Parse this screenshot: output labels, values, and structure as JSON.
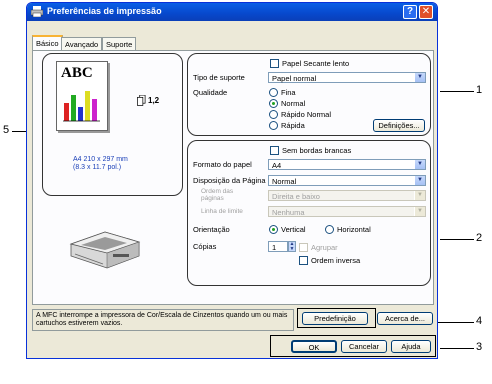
{
  "window": {
    "title": "Preferências de impressão",
    "help_label": "?",
    "close_label": "✕"
  },
  "tabs": [
    {
      "label": "Básico",
      "active": true
    },
    {
      "label": "Avançado",
      "active": false
    },
    {
      "label": "Suporte",
      "active": false
    }
  ],
  "preview": {
    "logo_text": "ABC",
    "page_size_text": "A4 210 x 297 mm",
    "page_size_inches": "(8.3 x 11.7 pol.)",
    "copies_indicator": "1,2"
  },
  "media": {
    "dry_paper_checkbox": {
      "label": "Papel Secante lento",
      "checked": false
    },
    "media_type_label": "Tipo de suporte",
    "media_type_value": "Papel normal",
    "quality_label": "Qualidade",
    "quality_options": [
      {
        "label": "Fina",
        "selected": false
      },
      {
        "label": "Normal",
        "selected": true
      },
      {
        "label": "Rápido Normal",
        "selected": false
      },
      {
        "label": "Rápida",
        "selected": false
      }
    ],
    "settings_button": "Definições..."
  },
  "layout": {
    "borderless_checkbox": {
      "label": "Sem bordas brancas",
      "checked": false
    },
    "paper_size_label": "Formato do papel",
    "paper_size_value": "A4",
    "page_layout_label": "Disposição da Página",
    "page_layout_value": "Normal",
    "page_order_label_1": "Ordem das",
    "page_order_label_2": "páginas",
    "page_order_value": "Direita e baixo",
    "border_line_label": "Linha de limite",
    "border_line_value": "Nenhuma",
    "orientation_label": "Orientação",
    "orientation_options": [
      {
        "label": "Vertical",
        "selected": true
      },
      {
        "label": "Horizontal",
        "selected": false
      }
    ],
    "copies_label": "Cópias",
    "copies_value": "1",
    "collate_label": "Agrupar",
    "reverse_order_label": "Ordem inversa"
  },
  "info_text": "A MFC interrompe a impressora de Cor/Escala de Cinzentos quando um ou mais cartuchos estiverem vazios.",
  "buttons": {
    "default": "Predefinição",
    "about": "Acerca de...",
    "ok": "OK",
    "cancel": "Cancelar",
    "help": "Ajuda"
  },
  "callouts": [
    "1",
    "2",
    "3",
    "4",
    "5"
  ],
  "colors": {
    "titlebar": "#0a5fe6",
    "dialog_face": "#ece9d8",
    "radio_selected": "#21a121"
  }
}
